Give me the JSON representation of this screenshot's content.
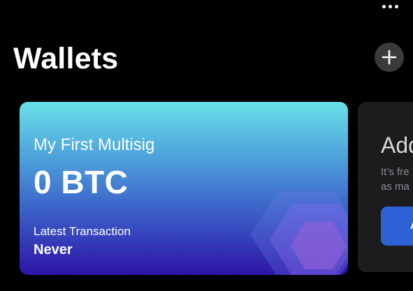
{
  "header": {
    "title": "Wallets",
    "more_icon": "more-horizontal-icon",
    "add_icon": "plus-icon"
  },
  "wallet_card": {
    "name": "My First Multisig",
    "balance": "0 BTC",
    "latest_label": "Latest Transaction",
    "latest_value": "Never",
    "gradient_top": "#68e0e8",
    "gradient_bottom": "#2d14a6",
    "art_icon": "hexagon-icon"
  },
  "add_card": {
    "title_visible": "Add",
    "text_line_1": "It’s fre",
    "text_line_2": "as ma",
    "button_label": "A"
  },
  "colors": {
    "background": "#000000",
    "add_button_bg": "#3a3a3c",
    "side_card_bg": "#1c1c1e",
    "accent_blue": "#2c62d6"
  }
}
